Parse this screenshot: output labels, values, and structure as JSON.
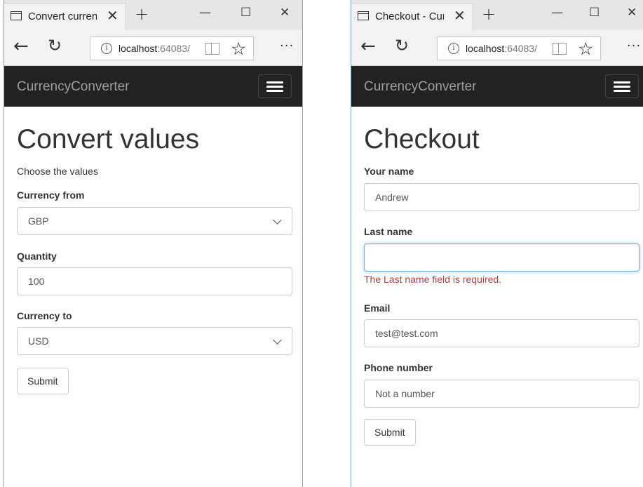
{
  "left_window": {
    "tab": {
      "title": "Convert currency",
      "close": "✕"
    },
    "new_tab": "+",
    "window_controls": {
      "minimize": "—",
      "maximize": "☐",
      "close": "✕"
    },
    "nav": {
      "back": "←",
      "refresh": "↻"
    },
    "address": {
      "host": "localhost",
      "port": ":64083/"
    },
    "more": "···",
    "navbar": {
      "brand": "CurrencyConverter"
    },
    "page": {
      "title": "Convert values",
      "intro": "Choose the values",
      "currency_from_label": "Currency from",
      "currency_from_value": "GBP",
      "quantity_label": "Quantity",
      "quantity_value": "100",
      "currency_to_label": "Currency to",
      "currency_to_value": "USD",
      "submit_label": "Submit"
    }
  },
  "right_window": {
    "tab": {
      "title": "Checkout - Currency",
      "close": "✕"
    },
    "new_tab": "+",
    "window_controls": {
      "minimize": "—",
      "maximize": "☐",
      "close": "✕"
    },
    "nav": {
      "back": "←",
      "refresh": "↻"
    },
    "address": {
      "host": "localhost",
      "port": ":64083/"
    },
    "more": "···",
    "navbar": {
      "brand": "CurrencyConverter"
    },
    "page": {
      "title": "Checkout",
      "your_name_label": "Your name",
      "your_name_value": "Andrew",
      "last_name_label": "Last name",
      "last_name_value": "",
      "last_name_error": "The Last name field is required.",
      "email_label": "Email",
      "email_value": "test@test.com",
      "phone_label": "Phone number",
      "phone_value": "Not a number",
      "submit_label": "Submit"
    }
  },
  "colors": {
    "navbar_bg": "#222222",
    "brand_text": "#9d9d9d",
    "error_text": "#a94442",
    "focus_border": "#66afe9",
    "window_border": "#7fa6c9"
  }
}
